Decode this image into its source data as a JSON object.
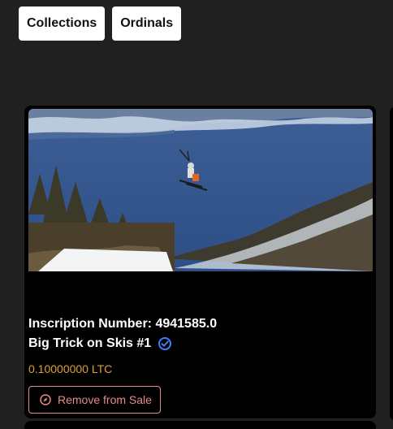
{
  "nav": {
    "collections_label": "Collections",
    "ordinals_label": "Ordinals"
  },
  "card": {
    "image_subject": "skier jumping over a lake",
    "inscription_text": "Inscription Number: 4941585.0",
    "title": "Big Trick on Skis #1",
    "verified_icon": "verified-check-icon",
    "price": "0.10000000 LTC",
    "remove_label": "Remove from Sale",
    "remove_icon": "compass-icon"
  },
  "colors": {
    "background": "#202020",
    "card": "#000000",
    "price": "#e0a030",
    "remove": "#e98a8a",
    "verified": "#3b82f6"
  }
}
